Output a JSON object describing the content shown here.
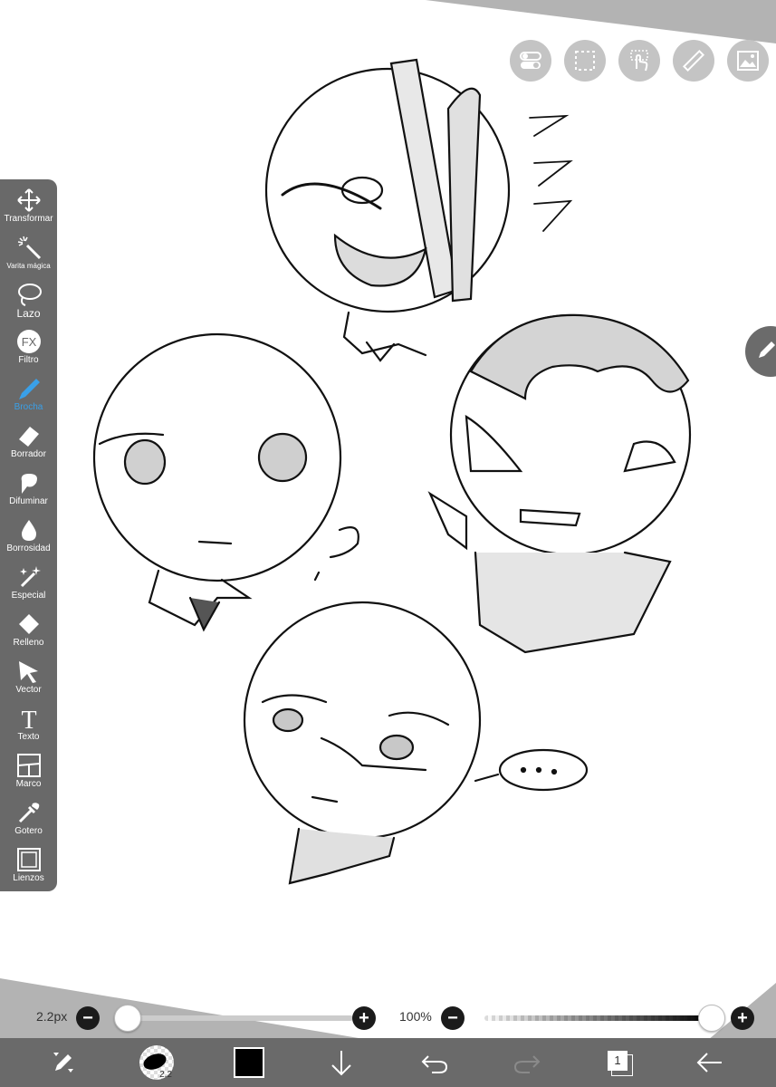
{
  "toolbar": {
    "tools": [
      {
        "label": "Transformar",
        "icon": "move-arrows-icon"
      },
      {
        "label": "Varita mágica",
        "icon": "magic-wand-icon"
      },
      {
        "label": "Lazo",
        "icon": "lasso-icon"
      },
      {
        "label": "Filtro",
        "icon": "fx-icon",
        "icon_text": "FX"
      },
      {
        "label": "Brocha",
        "icon": "brush-icon",
        "active": true
      },
      {
        "label": "Borrador",
        "icon": "eraser-icon"
      },
      {
        "label": "Difuminar",
        "icon": "smudge-icon"
      },
      {
        "label": "Borrosidad",
        "icon": "blur-drop-icon"
      },
      {
        "label": "Especial",
        "icon": "special-sparkle-icon"
      },
      {
        "label": "Relleno",
        "icon": "fill-bucket-icon"
      },
      {
        "label": "Vector",
        "icon": "vector-arrow-icon"
      },
      {
        "label": "Texto",
        "icon": "text-icon",
        "icon_text": "T"
      },
      {
        "label": "Marco",
        "icon": "frame-icon"
      },
      {
        "label": "Gotero",
        "icon": "eyedropper-icon"
      },
      {
        "label": "Lienzos",
        "icon": "canvas-icon"
      }
    ]
  },
  "top_buttons": [
    "toggle-icon",
    "selection-icon",
    "touch-icon",
    "ruler-icon",
    "image-icon"
  ],
  "brush_size": {
    "value": "2.2px",
    "fraction": 0.0
  },
  "opacity": {
    "value": "100%",
    "fraction": 1.0
  },
  "bottom_bar": {
    "brush_badge": "2.2",
    "layer_count": "1"
  },
  "colors": {
    "current_color": "#000000",
    "toolbar_bg": "#696969",
    "active_tool": "#3aa0e8"
  }
}
